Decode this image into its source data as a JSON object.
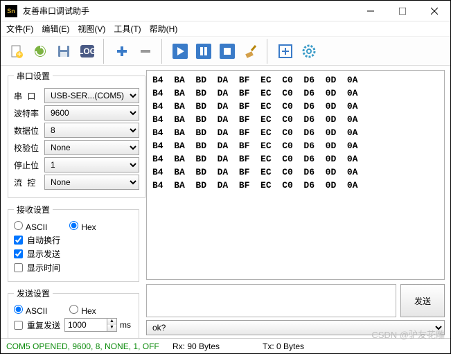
{
  "window": {
    "title": "友善串口调试助手"
  },
  "menu": {
    "file": "文件(F)",
    "edit": "编辑(E)",
    "view": "视图(V)",
    "tools": "工具(T)",
    "help": "帮助(H)"
  },
  "groups": {
    "serial": {
      "legend": "串口设置",
      "port_label": "串  口",
      "port_value": "USB-SER...(COM5)",
      "baud_label": "波特率",
      "baud_value": "9600",
      "data_label": "数据位",
      "data_value": "8",
      "parity_label": "校验位",
      "parity_value": "None",
      "stop_label": "停止位",
      "stop_value": "1",
      "flow_label": "流  控",
      "flow_value": "None"
    },
    "recv": {
      "legend": "接收设置",
      "ascii": "ASCII",
      "hex": "Hex",
      "wrap": "自动换行",
      "showtx": "显示发送",
      "showtime": "显示时间"
    },
    "send": {
      "legend": "发送设置",
      "ascii": "ASCII",
      "hex": "Hex",
      "repeat": "重复发送",
      "interval": "1000",
      "unit": "ms"
    }
  },
  "hex_lines": [
    "B4  BA  BD  DA  BF  EC  C0  D6  0D  0A",
    "B4  BA  BD  DA  BF  EC  C0  D6  0D  0A",
    "B4  BA  BD  DA  BF  EC  C0  D6  0D  0A",
    "B4  BA  BD  DA  BF  EC  C0  D6  0D  0A",
    "B4  BA  BD  DA  BF  EC  C0  D6  0D  0A",
    "B4  BA  BD  DA  BF  EC  C0  D6  0D  0A",
    "B4  BA  BD  DA  BF  EC  C0  D6  0D  0A",
    "B4  BA  BD  DA  BF  EC  C0  D6  0D  0A",
    "B4  BA  BD  DA  BF  EC  C0  D6  0D  0A"
  ],
  "send_button": "发送",
  "history_value": "ok?",
  "status": {
    "conn": "COM5 OPENED, 9600, 8, NONE, 1, OFF",
    "rx": "Rx: 90 Bytes",
    "tx": "Tx: 0 Bytes"
  },
  "watermark": "CSDN @驴友花雕"
}
